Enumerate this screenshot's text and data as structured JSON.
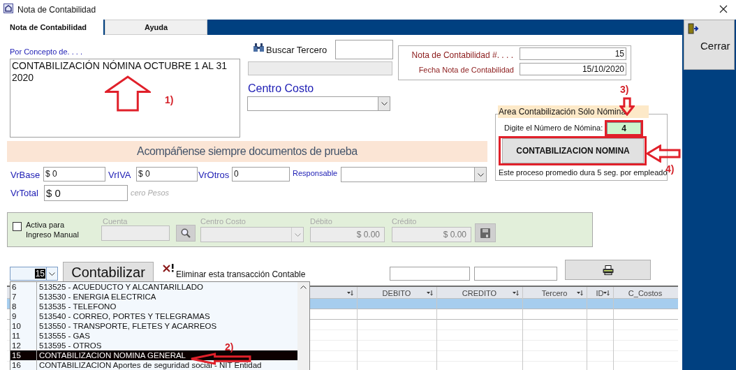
{
  "window": {
    "title": "Nota de Contabilidad"
  },
  "tabs": [
    {
      "label": "Nota de Contabilidad",
      "selected": true
    },
    {
      "label": "Ayuda",
      "selected": false
    }
  ],
  "close_button": {
    "label": "Cerrar"
  },
  "concepto": {
    "label": "Por Concepto de. . . .",
    "value": "CONTABILIZACIÓN NÓMINA OCTUBRE 1 AL 31 2020"
  },
  "buscar_tercero": {
    "label": "Buscar Tercero"
  },
  "centro_costo": {
    "label": "Centro Costo"
  },
  "nota": {
    "number_label": "Nota de Contabilidad #. . . .",
    "number": "15",
    "date_label": "Fecha Nota de Contabilidad",
    "date": "15/10/2020"
  },
  "nomina_area": {
    "title": "Area Contabilización Sólo Nómina",
    "prompt": "Digite el Número de Nómina:",
    "number": "4",
    "button": "CONTABILIZACION NOMINA",
    "note": "Este proceso promedio dura 5 seg. por empleado"
  },
  "banner": "Acompáñense siempre documentos de prueba",
  "amounts": [
    {
      "label": "VrBase",
      "value": "$ 0"
    },
    {
      "label": "VrIVA",
      "value": "$ 0"
    },
    {
      "label": "VrOtros",
      "value": "0"
    }
  ],
  "responsable": {
    "label": "Responsable"
  },
  "total": {
    "label": "VrTotal",
    "value": "$ 0",
    "in_words": "cero Pesos"
  },
  "manual_entry": {
    "checked": false,
    "disabled": true,
    "label": "Activa para Ingreso Manual",
    "cuenta_label": "Cuenta",
    "centro_costo_label": "Centro Costo",
    "debito_label": "Débito",
    "debito": "$ 0.00",
    "credito_label": "Crédito",
    "credito": "$ 0.00"
  },
  "transaction": {
    "selector_value": "15",
    "post_button": "Contabilizar",
    "delete_link": "Eliminar esta transacción Contable"
  },
  "account_dropdown": {
    "items": [
      {
        "code": "6",
        "name": "513525 - ACUEDUCTO Y ALCANTARILLADO",
        "selected": false
      },
      {
        "code": "7",
        "name": "513530 - ENERGIA ELECTRICA",
        "selected": false
      },
      {
        "code": "8",
        "name": "513535 - TELEFONO",
        "selected": false
      },
      {
        "code": "9",
        "name": "513540 - CORREO, PORTES Y TELEGRAMAS",
        "selected": false
      },
      {
        "code": "10",
        "name": "513550 - TRANSPORTE, FLETES Y ACARREOS",
        "selected": false
      },
      {
        "code": "11",
        "name": "513555 - GAS",
        "selected": false
      },
      {
        "code": "12",
        "name": "513595 - OTROS",
        "selected": false
      },
      {
        "code": "15",
        "name": "CONTABILIZACION NOMINA GENERAL",
        "selected": true
      },
      {
        "code": "16",
        "name": "CONTABILIZACION Aportes de seguridad social - NIT Entidad",
        "selected": false
      }
    ]
  },
  "table": {
    "columns": [
      "DEBITO",
      "CREDITO",
      "Tercero",
      "ID",
      "C_Costos"
    ]
  },
  "annotations": [
    {
      "label": "1)",
      "kind": "up"
    },
    {
      "label": "2)",
      "kind": "left"
    },
    {
      "label": "3)",
      "kind": "down"
    },
    {
      "label": "4)",
      "kind": "left"
    }
  ]
}
